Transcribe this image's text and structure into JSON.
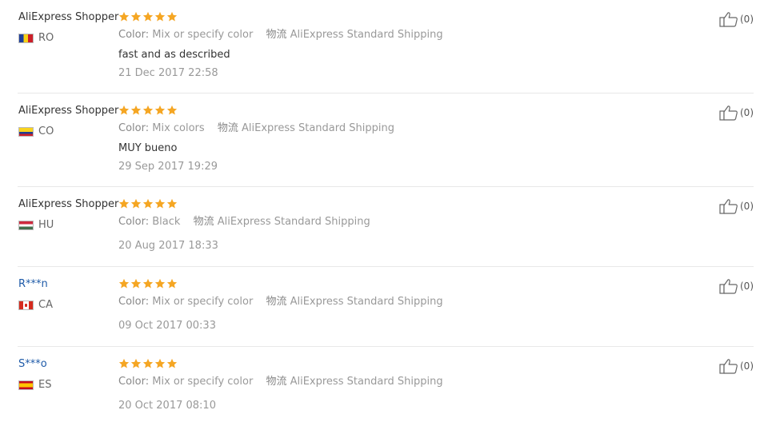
{
  "colors": {
    "star": "#f5a623",
    "link_name": "#1e5aa8",
    "divider": "#e8e8e8"
  },
  "reviews": [
    {
      "user": "AliExpress Shopper",
      "user_is_link": false,
      "country_code": "RO",
      "flag": "flag-ro-icon",
      "stars": 5,
      "color_label": "Color:",
      "color_value": "Mix or specify color",
      "logistics_label": "物流",
      "logistics_value": "AliExpress Standard Shipping",
      "text": "fast and as described",
      "date": "21 Dec 2017 22:58",
      "helpful": "(0)"
    },
    {
      "user": "AliExpress Shopper",
      "user_is_link": false,
      "country_code": "CO",
      "flag": "flag-co-icon",
      "stars": 5,
      "color_label": "Color:",
      "color_value": "Mix colors",
      "logistics_label": "物流",
      "logistics_value": "AliExpress Standard Shipping",
      "text": "MUY bueno",
      "date": "29 Sep 2017 19:29",
      "helpful": "(0)"
    },
    {
      "user": "AliExpress Shopper",
      "user_is_link": false,
      "country_code": "HU",
      "flag": "flag-hu-icon",
      "stars": 5,
      "color_label": "Color:",
      "color_value": "Black",
      "logistics_label": "物流",
      "logistics_value": "AliExpress Standard Shipping",
      "text": "",
      "date": "20 Aug 2017 18:33",
      "helpful": "(0)"
    },
    {
      "user": "R***n",
      "user_is_link": true,
      "country_code": "CA",
      "flag": "flag-ca-icon",
      "stars": 5,
      "color_label": "Color:",
      "color_value": "Mix or specify color",
      "logistics_label": "物流",
      "logistics_value": "AliExpress Standard Shipping",
      "text": "",
      "date": "09 Oct 2017 00:33",
      "helpful": "(0)"
    },
    {
      "user": "S***o",
      "user_is_link": true,
      "country_code": "ES",
      "flag": "flag-es-icon",
      "stars": 5,
      "color_label": "Color:",
      "color_value": "Mix or specify color",
      "logistics_label": "物流",
      "logistics_value": "AliExpress Standard Shipping",
      "text": "",
      "date": "20 Oct 2017 08:10",
      "helpful": "(0)"
    }
  ]
}
